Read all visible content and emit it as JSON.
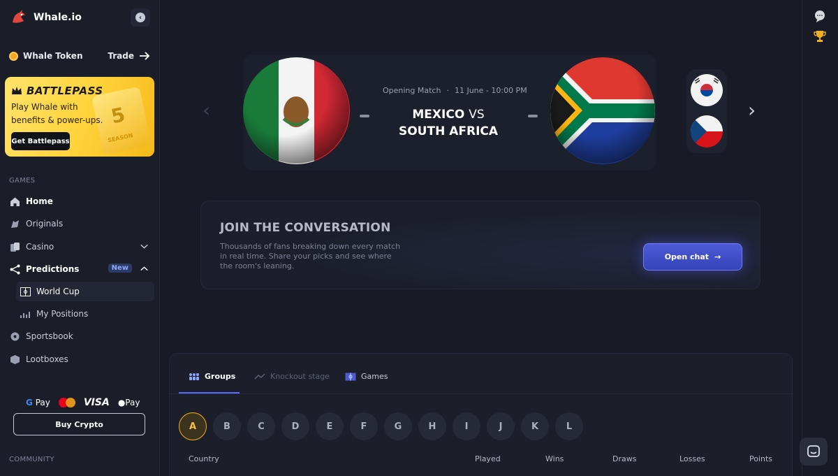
{
  "brand": {
    "name": "Whale.io"
  },
  "token": {
    "label": "Whale Token",
    "action": "Trade"
  },
  "battlepass": {
    "title": "BATTLEPASS",
    "desc": "Play Whale with benefits & power-ups.",
    "button": "Get Battlepass",
    "ticket_number": "5",
    "ticket_text": "SEASON"
  },
  "sidebar": {
    "games_label": "GAMES",
    "home": "Home",
    "originals": "Originals",
    "casino": "Casino",
    "predictions": "Predictions",
    "predictions_badge": "New",
    "world_cup": "World Cup",
    "my_positions": "My Positions",
    "sportsbook": "Sportsbook",
    "lootboxes": "Lootboxes",
    "community_label": "COMMUNITY"
  },
  "payments": {
    "gpay": "Pay",
    "visa": "VISA",
    "apple_pay": "Pay",
    "buy_button": "Buy Crypto"
  },
  "hero": {
    "label": "Opening Match",
    "date": "11 June - 10:00 PM",
    "team_home": "MEXICO",
    "vs": "VS",
    "team_away": "SOUTH AFRICA"
  },
  "conversation": {
    "title": "JOIN THE CONVERSATION",
    "desc": "Thousands of fans breaking down every match in real time. Share your picks and see where the room's leaning.",
    "button": "Open chat"
  },
  "tabs": [
    {
      "label": "Groups",
      "active": true
    },
    {
      "label": "Knockout stage",
      "active": false
    },
    {
      "label": "Games",
      "active": false
    }
  ],
  "groups": [
    "A",
    "B",
    "C",
    "D",
    "E",
    "F",
    "G",
    "H",
    "I",
    "J",
    "K",
    "L"
  ],
  "selected_group": "A",
  "table_headers": [
    "Country",
    "Played",
    "Wins",
    "Draws",
    "Losses",
    "Points"
  ],
  "colors": {
    "accent": "#5c6bff",
    "gold": "#f2b01e",
    "bg": "#181b25"
  }
}
